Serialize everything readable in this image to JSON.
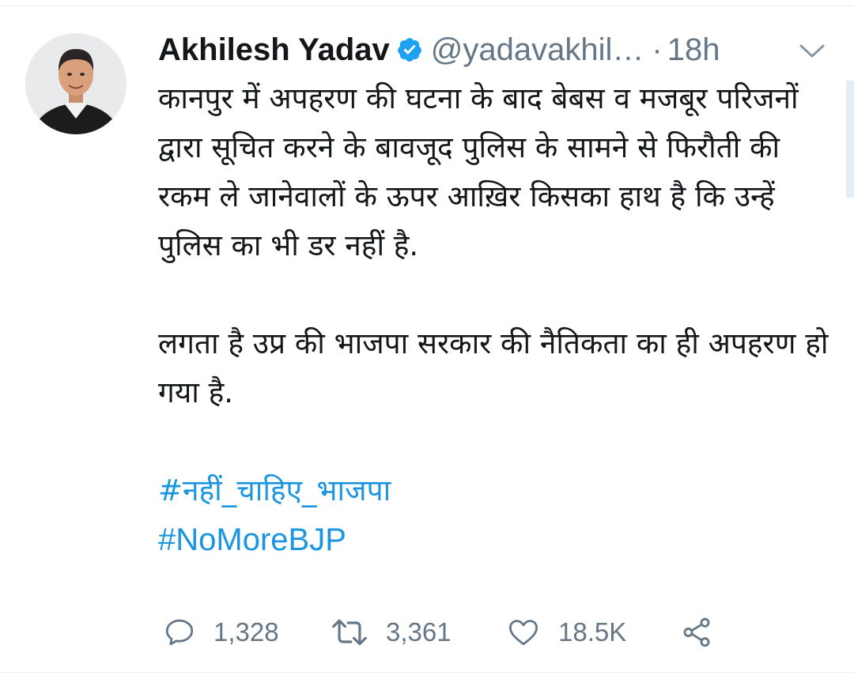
{
  "tweet": {
    "author": {
      "name": "Akhilesh Yadav",
      "handle": "@yadavakhil…",
      "verified": true
    },
    "separator": "·",
    "time": "18h",
    "body": {
      "paragraph1": "कानपुर में अपहरण की घटना के बाद बेबस व मजबूर परिजनों द्वारा सूचित करने के बावजूद पुलिस के सामने से फिरौती की रकम ले जानेवालों के ऊपर आख़िर किसका हाथ है कि उन्हें पुलिस का भी डर नहीं है.",
      "paragraph2": "लगता है उप्र की भाजपा सरकार की नैतिकता का ही अपहरण हो गया है.",
      "hashtag1": "#नहीं_चाहिए_भाजपा",
      "hashtag2": "#NoMoreBJP"
    },
    "actions": {
      "replies": "1,328",
      "retweets": "3,361",
      "likes": "18.5K"
    },
    "colors": {
      "text": "#14171a",
      "secondary": "#657786",
      "link": "#1b95e0",
      "verified": "#1da1f2"
    },
    "icons": [
      "verified-badge-icon",
      "chevron-down-icon",
      "reply-icon",
      "retweet-icon",
      "like-icon",
      "share-icon"
    ]
  }
}
